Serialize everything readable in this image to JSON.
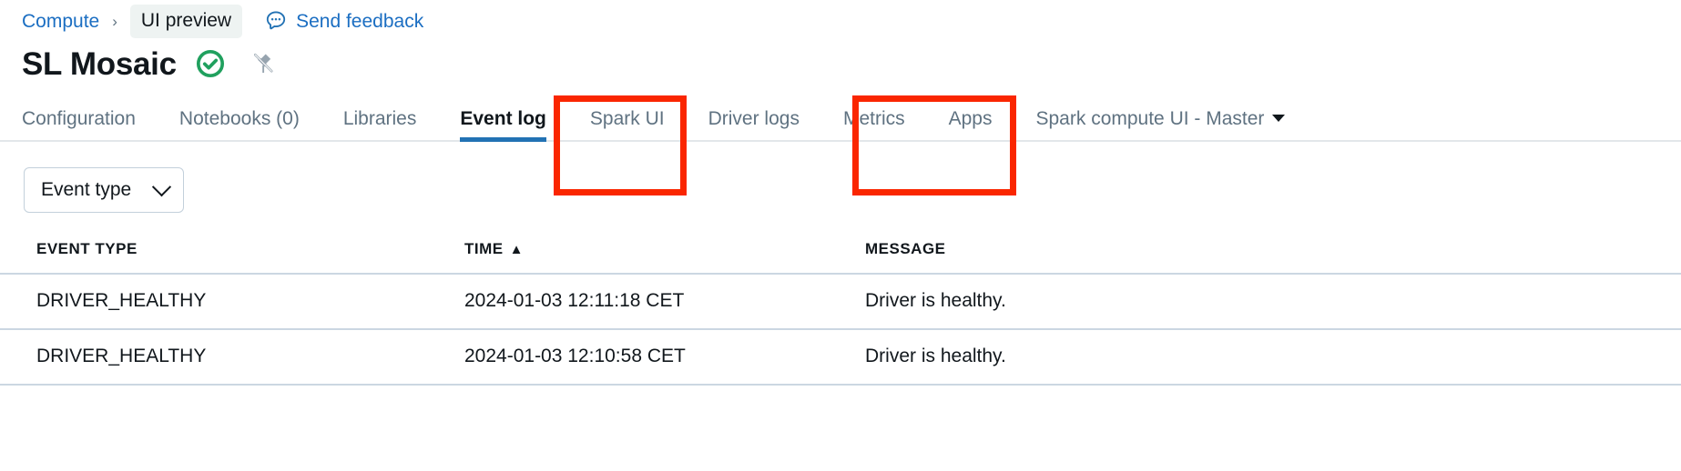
{
  "breadcrumb": {
    "parent_label": "Compute",
    "separator": "›",
    "preview_badge": "UI preview",
    "feedback_icon": "speech-bubble-icon",
    "feedback_label": "Send feedback"
  },
  "header": {
    "title": "SL Mosaic",
    "status_icon": "check-circle-icon",
    "status_color": "#20A05E",
    "pin_icon": "pin-off-icon",
    "pin_color": "#97A4AF"
  },
  "tabs": {
    "active": "Event log",
    "accent_color": "#2272B4",
    "items": [
      {
        "label": "Configuration",
        "active": false,
        "dropdown": false
      },
      {
        "label": "Notebooks (0)",
        "active": false,
        "dropdown": false
      },
      {
        "label": "Libraries",
        "active": false,
        "dropdown": false
      },
      {
        "label": "Event log",
        "active": true,
        "dropdown": false
      },
      {
        "label": "Spark UI",
        "active": false,
        "dropdown": false
      },
      {
        "label": "Driver logs",
        "active": false,
        "dropdown": false
      },
      {
        "label": "Metrics",
        "active": false,
        "dropdown": false
      },
      {
        "label": "Apps",
        "active": false,
        "dropdown": false
      },
      {
        "label": "Spark compute UI - Master",
        "active": false,
        "dropdown": true
      }
    ]
  },
  "annotations": {
    "color": "#FA2600",
    "boxes": [
      {
        "target": "Event log"
      },
      {
        "target": "Driver logs"
      }
    ]
  },
  "filters": {
    "event_type": {
      "label": "Event type",
      "chevron_icon": "chevron-down-icon"
    }
  },
  "table": {
    "columns": [
      {
        "key": "event_type",
        "label": "EVENT TYPE",
        "sorted": false
      },
      {
        "key": "time",
        "label": "TIME",
        "sorted": true,
        "sort_arrow": "▲"
      },
      {
        "key": "message",
        "label": "MESSAGE",
        "sorted": false
      }
    ],
    "rows": [
      {
        "event_type": "DRIVER_HEALTHY",
        "time": "2024-01-03 12:11:18 CET",
        "message": "Driver is healthy."
      },
      {
        "event_type": "DRIVER_HEALTHY",
        "time": "2024-01-03 12:10:58 CET",
        "message": "Driver is healthy."
      }
    ]
  }
}
